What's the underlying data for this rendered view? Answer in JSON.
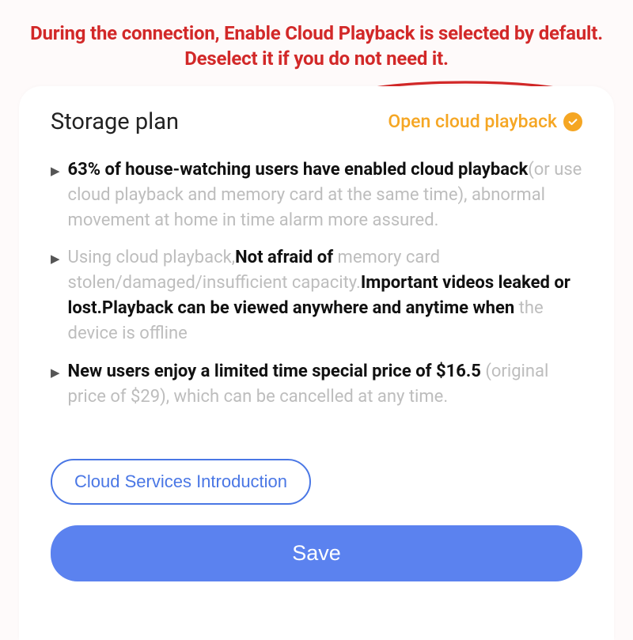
{
  "annotation": {
    "text": "During the connection, Enable Cloud Playback is selected by default. Deselect it if you do not need it."
  },
  "header": {
    "title": "Storage plan",
    "toggle_label": "Open cloud playback"
  },
  "bullets": [
    {
      "lead_bold": "63% of house-watching users have enabled cloud playback",
      "tail_light": "(or use cloud playback and memory card at the same time), abnormal movement at home in time alarm more assured."
    },
    {
      "lead_light": "Using cloud playback,",
      "mid_bold_1": "Not afraid of ",
      "mid_light": "memory card stolen/damaged/insufficient capacity.",
      "tail_bold": "Important videos leaked or lost.Playback can be viewed anywhere and anytime when ",
      "tail_light": "the device is offline"
    },
    {
      "lead_bold": "New users enjoy a limited time special price of $16.5",
      "tail_light": " (original price of $29), which can be cancelled at any time."
    }
  ],
  "buttons": {
    "intro": "Cloud Services Introduction",
    "save": "Save"
  },
  "colors": {
    "annotation": "#d22828",
    "accent_orange": "#f5a623",
    "accent_blue": "#4a77e5",
    "save_blue": "#5b82ef",
    "light_text": "#bdbdbd"
  }
}
